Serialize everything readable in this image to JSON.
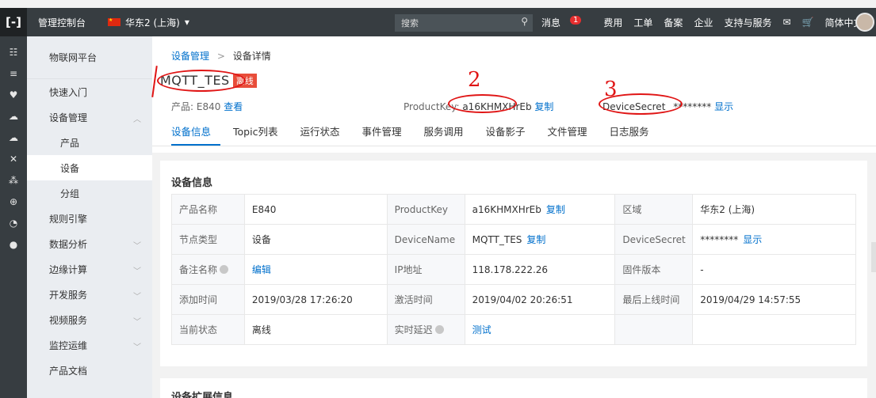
{
  "topbar": {
    "logo": "[-]",
    "console": "管理控制台",
    "region": "华东2 (上海)",
    "region_arrow": "▾",
    "search_placeholder": "搜索",
    "search_icon": "⚲",
    "messages": "消息",
    "message_count": "1",
    "links": [
      "费用",
      "工单",
      "备案",
      "企业",
      "支持与服务"
    ],
    "mail_icon": "✉",
    "cart_icon": "🛒",
    "language": "简体中文"
  },
  "iconbar": [
    "☷",
    "≡",
    "♥",
    "☁",
    "☁",
    "✕",
    "⁂",
    "⊕",
    "◔",
    "●"
  ],
  "sidebar": {
    "title": "物联网平台",
    "items": [
      {
        "label": "快速入门",
        "sub": false,
        "chev": ""
      },
      {
        "label": "设备管理",
        "sub": false,
        "chev": "︿"
      },
      {
        "label": "产品",
        "sub": true,
        "chev": ""
      },
      {
        "label": "设备",
        "sub": true,
        "chev": "",
        "active": true
      },
      {
        "label": "分组",
        "sub": true,
        "chev": ""
      },
      {
        "label": "规则引擎",
        "sub": false,
        "chev": ""
      },
      {
        "label": "数据分析",
        "sub": false,
        "chev": "﹀"
      },
      {
        "label": "边缘计算",
        "sub": false,
        "chev": "﹀"
      },
      {
        "label": "开发服务",
        "sub": false,
        "chev": "﹀"
      },
      {
        "label": "视频服务",
        "sub": false,
        "chev": "﹀"
      },
      {
        "label": "监控运维",
        "sub": false,
        "chev": "﹀"
      },
      {
        "label": "产品文档",
        "sub": false,
        "chev": ""
      }
    ]
  },
  "breadcrumb": {
    "parent": "设备管理",
    "sep": ">",
    "current": "设备详情"
  },
  "device": {
    "name": "MQTT_TES",
    "status": "离线",
    "product_label": "产品: E840",
    "product_view": "查看",
    "productkey_label": "ProductKey:",
    "productkey_value": "a16KHMXHrEb",
    "copy": "复制",
    "devicesecret_label": "DeviceSecret",
    "devicesecret_value": "********",
    "show": "显示"
  },
  "annotations": {
    "one": "1",
    "two": "2",
    "three": "3"
  },
  "tabs": [
    "设备信息",
    "Topic列表",
    "运行状态",
    "事件管理",
    "服务调用",
    "设备影子",
    "文件管理",
    "日志服务"
  ],
  "info": {
    "title": "设备信息",
    "rows": [
      [
        {
          "k": "产品名称"
        },
        {
          "v": "E840"
        },
        {
          "k": "ProductKey"
        },
        {
          "v": "a16KHMXHrEb",
          "link": "复制"
        },
        {
          "k": "区域"
        },
        {
          "v": "华东2 (上海)"
        }
      ],
      [
        {
          "k": "节点类型"
        },
        {
          "v": "设备"
        },
        {
          "k": "DeviceName"
        },
        {
          "v": "MQTT_TES",
          "link": "复制"
        },
        {
          "k": "DeviceSecret"
        },
        {
          "v": "********",
          "link": "显示"
        }
      ],
      [
        {
          "k": "备注名称",
          "q": true
        },
        {
          "v": "",
          "link": "编辑"
        },
        {
          "k": "IP地址"
        },
        {
          "v": "118.178.222.26"
        },
        {
          "k": "固件版本"
        },
        {
          "v": "-"
        }
      ],
      [
        {
          "k": "添加时间"
        },
        {
          "v": "2019/03/28 17:26:20"
        },
        {
          "k": "激活时间"
        },
        {
          "v": "2019/04/02 20:26:51"
        },
        {
          "k": "最后上线时间"
        },
        {
          "v": "2019/04/29 14:57:55"
        }
      ],
      [
        {
          "k": "当前状态"
        },
        {
          "v": "离线"
        },
        {
          "k": "实时延迟",
          "q": true
        },
        {
          "v": "",
          "link": "测试"
        },
        {
          "k": ""
        },
        {
          "v": ""
        }
      ]
    ]
  },
  "ext_title": "设备扩展信息"
}
